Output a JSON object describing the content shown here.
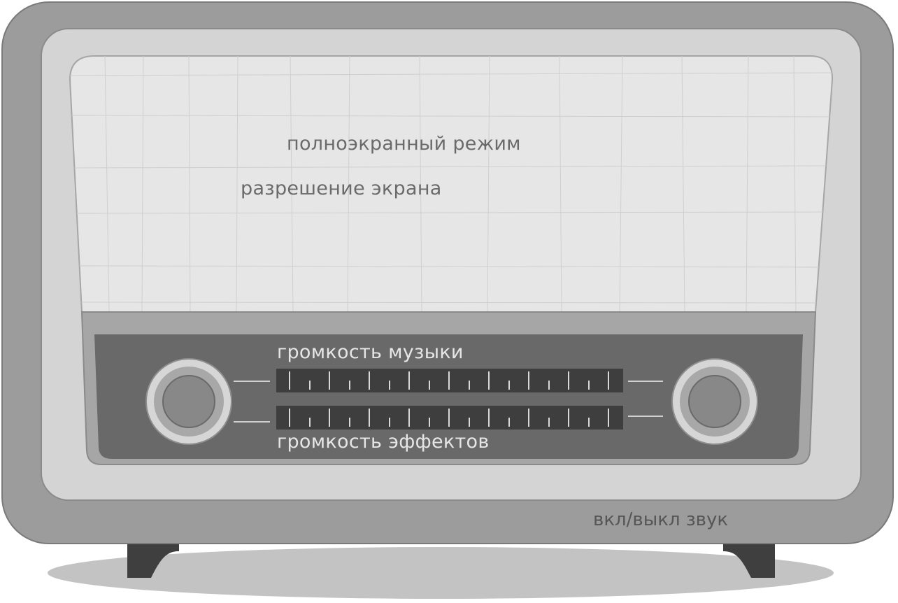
{
  "menu": {
    "fullscreen_label": "полноэкранный режим",
    "resolution_label": "разрешение экрана"
  },
  "sliders": {
    "music": {
      "label": "громкость музыки"
    },
    "effects": {
      "label": "громкость эффектов"
    }
  },
  "sound_toggle_label": "вкл/выкл звук",
  "colors": {
    "cabinet": "#9c9c9c",
    "inner_frame": "#d4d4d4",
    "screen": "#e6e6e6",
    "control_panel": "#696969",
    "slider_track": "#3e3e3e",
    "label_light": "#e6e6e6",
    "label_dark": "#6a6a6a"
  }
}
